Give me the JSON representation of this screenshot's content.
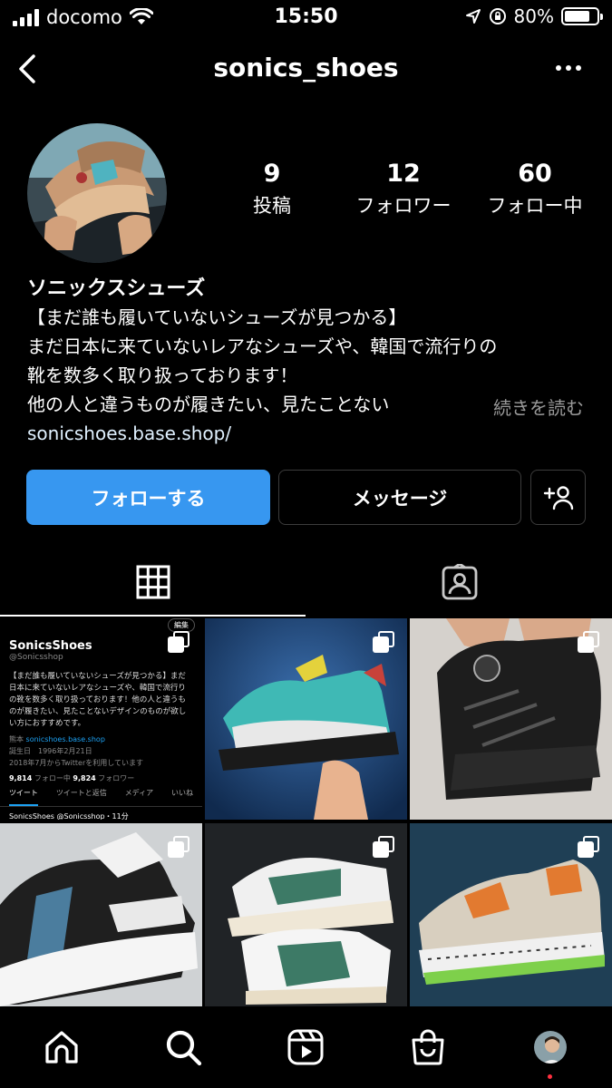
{
  "status_bar": {
    "carrier": "docomo",
    "time": "15:50",
    "battery": "80%",
    "battery_level": 0.8
  },
  "header": {
    "username": "sonics_shoes"
  },
  "stats": [
    {
      "value": "9",
      "label": "投稿"
    },
    {
      "value": "12",
      "label": "フォロワー"
    },
    {
      "value": "60",
      "label": "フォロー中"
    }
  ],
  "bio": {
    "name": "ソニックスシューズ",
    "lines": [
      "【まだ誰も履いていないシューズが見つかる】",
      "まだ日本に来ていないレアなシューズや、韓国で流行りの",
      "靴を数多く取り扱っております！",
      "他の人と違うものが履きたい、見たことない"
    ],
    "more": "続きを読む",
    "link": "sonicshoes.base.shop/"
  },
  "buttons": {
    "follow": "フォローする",
    "message": "メッセージ"
  },
  "tabs": [
    {
      "icon": "grid-icon",
      "active": true
    },
    {
      "icon": "tagged-person-icon",
      "active": false
    }
  ],
  "twitter_tile": {
    "edit": "編集",
    "name": "SonicsShoes",
    "handle": "@Sonicsshop",
    "bio": "【まだ誰も履いていないシューズが見つかる】まだ日本に来ていないレアなシューズや、韓国で流行りの靴を数多く取り扱っております！他の人と違うものが履きたい、見たことないデザインのものが欲しい方におすすめです。",
    "location": "熊本",
    "link": "sonicshoes.base.shop",
    "birthday": "誕生日　1996年2月21日",
    "joined": "2018年7月からTwitterを利用しています",
    "following_count": "9,814",
    "following_label": "フォロー中",
    "followers_count": "9,824",
    "followers_label": "フォロワー",
    "tabs": [
      "ツイート",
      "ツイートと返信",
      "メディア",
      "いいね"
    ],
    "next_tweet": "SonicsShoes @Sonicsshop・11分"
  },
  "grid": [
    {
      "kind": "screenshot",
      "multi": true
    },
    {
      "kind": "photo",
      "desc": "shoe-teal",
      "multi": true
    },
    {
      "kind": "photo",
      "desc": "shoe-black",
      "multi": true
    },
    {
      "kind": "photo",
      "desc": "shoe-white-black",
      "multi": true
    },
    {
      "kind": "photo",
      "desc": "shoe-green-white",
      "multi": true
    },
    {
      "kind": "photo",
      "desc": "shoe-orange-green",
      "multi": true
    }
  ],
  "bottom_nav": [
    {
      "icon": "home-icon"
    },
    {
      "icon": "search-icon"
    },
    {
      "icon": "reels-icon"
    },
    {
      "icon": "shop-icon"
    },
    {
      "icon": "profile-avatar"
    }
  ],
  "colors": {
    "accent": "#3797f0",
    "background": "#000000",
    "link": "#e0f1ff",
    "muted": "#9a9a9a"
  }
}
